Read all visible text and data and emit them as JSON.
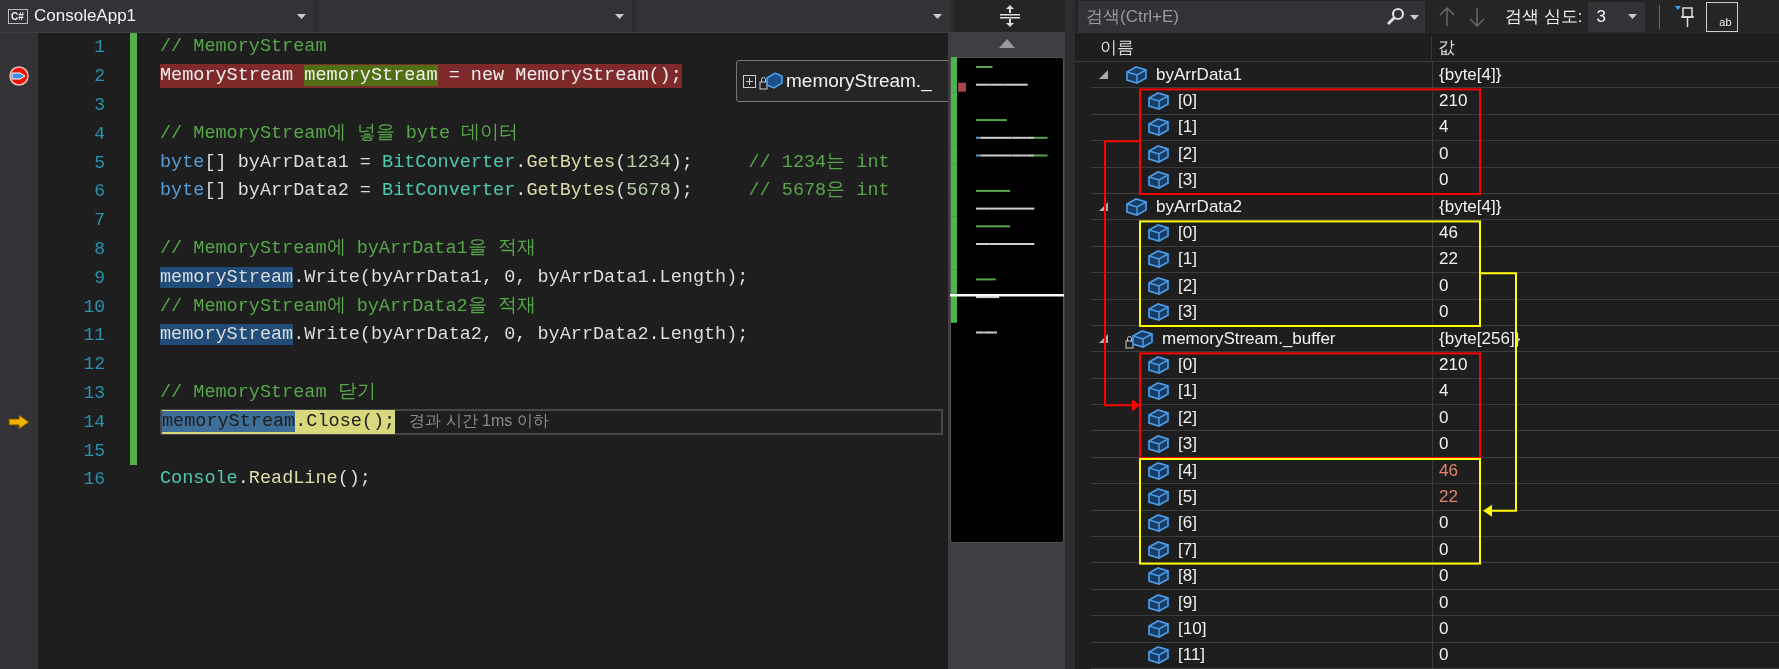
{
  "toolbar": {
    "dropdowns": [
      {
        "kind": "project",
        "badge": "C#",
        "label": "ConsoleApp1"
      },
      {
        "kind": "member"
      },
      {
        "kind": "member"
      }
    ]
  },
  "editor": {
    "lines": [
      {
        "number": "1",
        "kind": "plain",
        "modified": true,
        "tokens": [
          {
            "text": "// MemoryStream",
            "kind": "comment"
          }
        ]
      },
      {
        "number": "2",
        "kind": "breakpoint",
        "modified": true,
        "tokens": [
          {
            "text": "MemoryStream ",
            "kind": "plain"
          },
          {
            "text": "memoryStream",
            "kind": "plain",
            "highlighted": true
          },
          {
            "text": " = new MemoryStream();",
            "kind": "plain"
          }
        ]
      },
      {
        "number": "3",
        "kind": "plain",
        "modified": true
      },
      {
        "number": "4",
        "kind": "plain",
        "modified": true,
        "tokens": [
          {
            "text": "// MemoryStream에 넣을 byte 데이터",
            "kind": "comment"
          }
        ]
      },
      {
        "number": "5",
        "kind": "plain",
        "modified": true,
        "tokens": [
          {
            "text": "byte",
            "kind": "keyword"
          },
          {
            "text": "[] byArrData1 = ",
            "kind": "plain"
          },
          {
            "text": "BitConverter",
            "kind": "type"
          },
          {
            "text": ".",
            "kind": "plain"
          },
          {
            "text": "GetBytes",
            "kind": "method"
          },
          {
            "text": "(",
            "kind": "plain"
          },
          {
            "text": "1234",
            "kind": "number"
          },
          {
            "text": ");     ",
            "kind": "plain"
          },
          {
            "text": "// 1234는 int",
            "kind": "comment"
          }
        ]
      },
      {
        "number": "6",
        "kind": "plain",
        "modified": true,
        "tokens": [
          {
            "text": "byte",
            "kind": "keyword"
          },
          {
            "text": "[] byArrData2 = ",
            "kind": "plain"
          },
          {
            "text": "BitConverter",
            "kind": "type"
          },
          {
            "text": ".",
            "kind": "plain"
          },
          {
            "text": "GetBytes",
            "kind": "method"
          },
          {
            "text": "(",
            "kind": "plain"
          },
          {
            "text": "5678",
            "kind": "number"
          },
          {
            "text": ");     ",
            "kind": "plain"
          },
          {
            "text": "// 5678은 int",
            "kind": "comment"
          }
        ]
      },
      {
        "number": "7",
        "kind": "plain",
        "modified": true
      },
      {
        "number": "8",
        "kind": "plain",
        "modified": true,
        "tokens": [
          {
            "text": "// MemoryStream에 byArrData1을 적재",
            "kind": "comment"
          }
        ]
      },
      {
        "number": "9",
        "kind": "plain",
        "modified": true,
        "tokens": [
          {
            "text": "memoryStream",
            "kind": "plain",
            "highlighted": true
          },
          {
            "text": ".Write(byArrData1, 0, byArrData1.Length);",
            "kind": "plain"
          }
        ]
      },
      {
        "number": "10",
        "kind": "plain",
        "modified": true,
        "tokens": [
          {
            "text": "// MemoryStream에 byArrData2을 적재",
            "kind": "comment"
          }
        ]
      },
      {
        "number": "11",
        "kind": "plain",
        "modified": true,
        "tokens": [
          {
            "text": "memoryStream",
            "kind": "plain",
            "highlighted": true
          },
          {
            "text": ".Write(byArrData2, 0, byArrData2.Length);",
            "kind": "plain"
          }
        ]
      },
      {
        "number": "12",
        "kind": "plain",
        "modified": true
      },
      {
        "number": "13",
        "kind": "plain",
        "modified": true,
        "tokens": [
          {
            "text": "// MemoryStream 닫기",
            "kind": "comment"
          }
        ]
      },
      {
        "number": "14",
        "kind": "current",
        "modified": true,
        "perf_tip": "경과 시간 1ms 이하",
        "tokens": [
          {
            "text": "memoryStream",
            "kind": "plain",
            "highlighted": true
          },
          {
            "text": ".Close();",
            "kind": "plain"
          }
        ]
      },
      {
        "number": "15",
        "kind": "plain",
        "modified": true
      },
      {
        "number": "16",
        "kind": "plain",
        "modified": false,
        "tokens": [
          {
            "text": "Console",
            "kind": "type"
          },
          {
            "text": ".",
            "kind": "plain"
          },
          {
            "text": "ReadLine",
            "kind": "method"
          },
          {
            "text": "();",
            "kind": "plain"
          }
        ]
      }
    ],
    "data_tip": {
      "label": "memoryStream._"
    }
  },
  "watch": {
    "search": {
      "placeholder": "검색(Ctrl+E)"
    },
    "depth_label": "검색 심도:",
    "depth": "3",
    "view_button": "ab",
    "columns": [
      "이름",
      "값"
    ],
    "items": [
      {
        "name": "byArrData1",
        "value": "{byte[4]}",
        "expanded": true,
        "locked": false,
        "children": [
          {
            "name": "[0]",
            "value": "210",
            "changed": false,
            "color": "#ff0000"
          },
          {
            "name": "[1]",
            "value": "4",
            "changed": false,
            "color": "#ff0000",
            "arrow_start": {
              "color": "#ff0000",
              "kind": "left"
            }
          },
          {
            "name": "[2]",
            "value": "0",
            "changed": false,
            "color": "#ff0000"
          },
          {
            "name": "[3]",
            "value": "0",
            "changed": false,
            "color": "#ff0000"
          }
        ]
      },
      {
        "name": "byArrData2",
        "value": "{byte[4]}",
        "expanded": true,
        "locked": false,
        "children": [
          {
            "name": "[0]",
            "value": "46",
            "changed": false,
            "color": "#ffff00"
          },
          {
            "name": "[1]",
            "value": "22",
            "changed": false,
            "color": "#ffff00",
            "arrow_start": {
              "color": "#ffff00",
              "kind": "right"
            }
          },
          {
            "name": "[2]",
            "value": "0",
            "changed": false,
            "color": "#ffff00"
          },
          {
            "name": "[3]",
            "value": "0",
            "changed": false,
            "color": "#ffff00"
          }
        ]
      },
      {
        "name": "memoryStream._buffer",
        "value": "{byte[256]}",
        "expanded": true,
        "locked": true,
        "children": [
          {
            "name": "[0]",
            "value": "210",
            "changed": false,
            "color": "#ff0000"
          },
          {
            "name": "[1]",
            "value": "4",
            "changed": false,
            "color": "#ff0000",
            "arrow_end": {
              "color": "#ff0000"
            }
          },
          {
            "name": "[2]",
            "value": "0",
            "changed": false,
            "color": "#ff0000"
          },
          {
            "name": "[3]",
            "value": "0",
            "changed": false,
            "color": "#ff0000"
          },
          {
            "name": "[4]",
            "value": "46",
            "changed": true,
            "color": "#ffff00"
          },
          {
            "name": "[5]",
            "value": "22",
            "changed": true,
            "color": "#ffff00",
            "arrow_end": {
              "color": "#ffff00"
            }
          },
          {
            "name": "[6]",
            "value": "0",
            "changed": false,
            "color": "#ffff00"
          },
          {
            "name": "[7]",
            "value": "0",
            "changed": false,
            "color": "#ffff00"
          },
          {
            "name": "[8]",
            "value": "0",
            "changed": false
          },
          {
            "name": "[9]",
            "value": "0",
            "changed": false
          },
          {
            "name": "[10]",
            "value": "0",
            "changed": false
          },
          {
            "name": "[11]",
            "value": "0",
            "changed": false
          }
        ]
      }
    ]
  }
}
